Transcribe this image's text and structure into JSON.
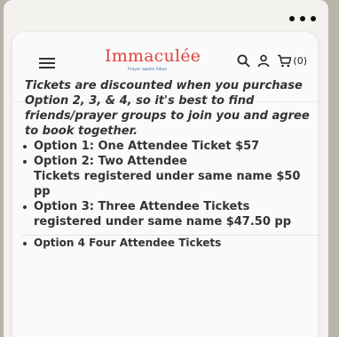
{
  "header": {
    "logo_text": "Immaculée",
    "logo_tagline": "Prayer awaits Ilibaz",
    "cart_count": "(0)"
  },
  "content": {
    "intro_partial": "'",
    "intro": "Tickets are discounted when you purchase Option 2, 3, & 4, so it's best to find friends/prayer groups to join you and agree to book together.",
    "options": [
      "Option 1:  One Attendee Ticket $57",
      "Option 2: Two Attendee",
      "Option 3: Three Attendee Tickets registered under same name $47.50 pp",
      "Option 4 Four Attendee Tickets"
    ],
    "option2_detail": "Tickets registered under same name $50 pp"
  }
}
